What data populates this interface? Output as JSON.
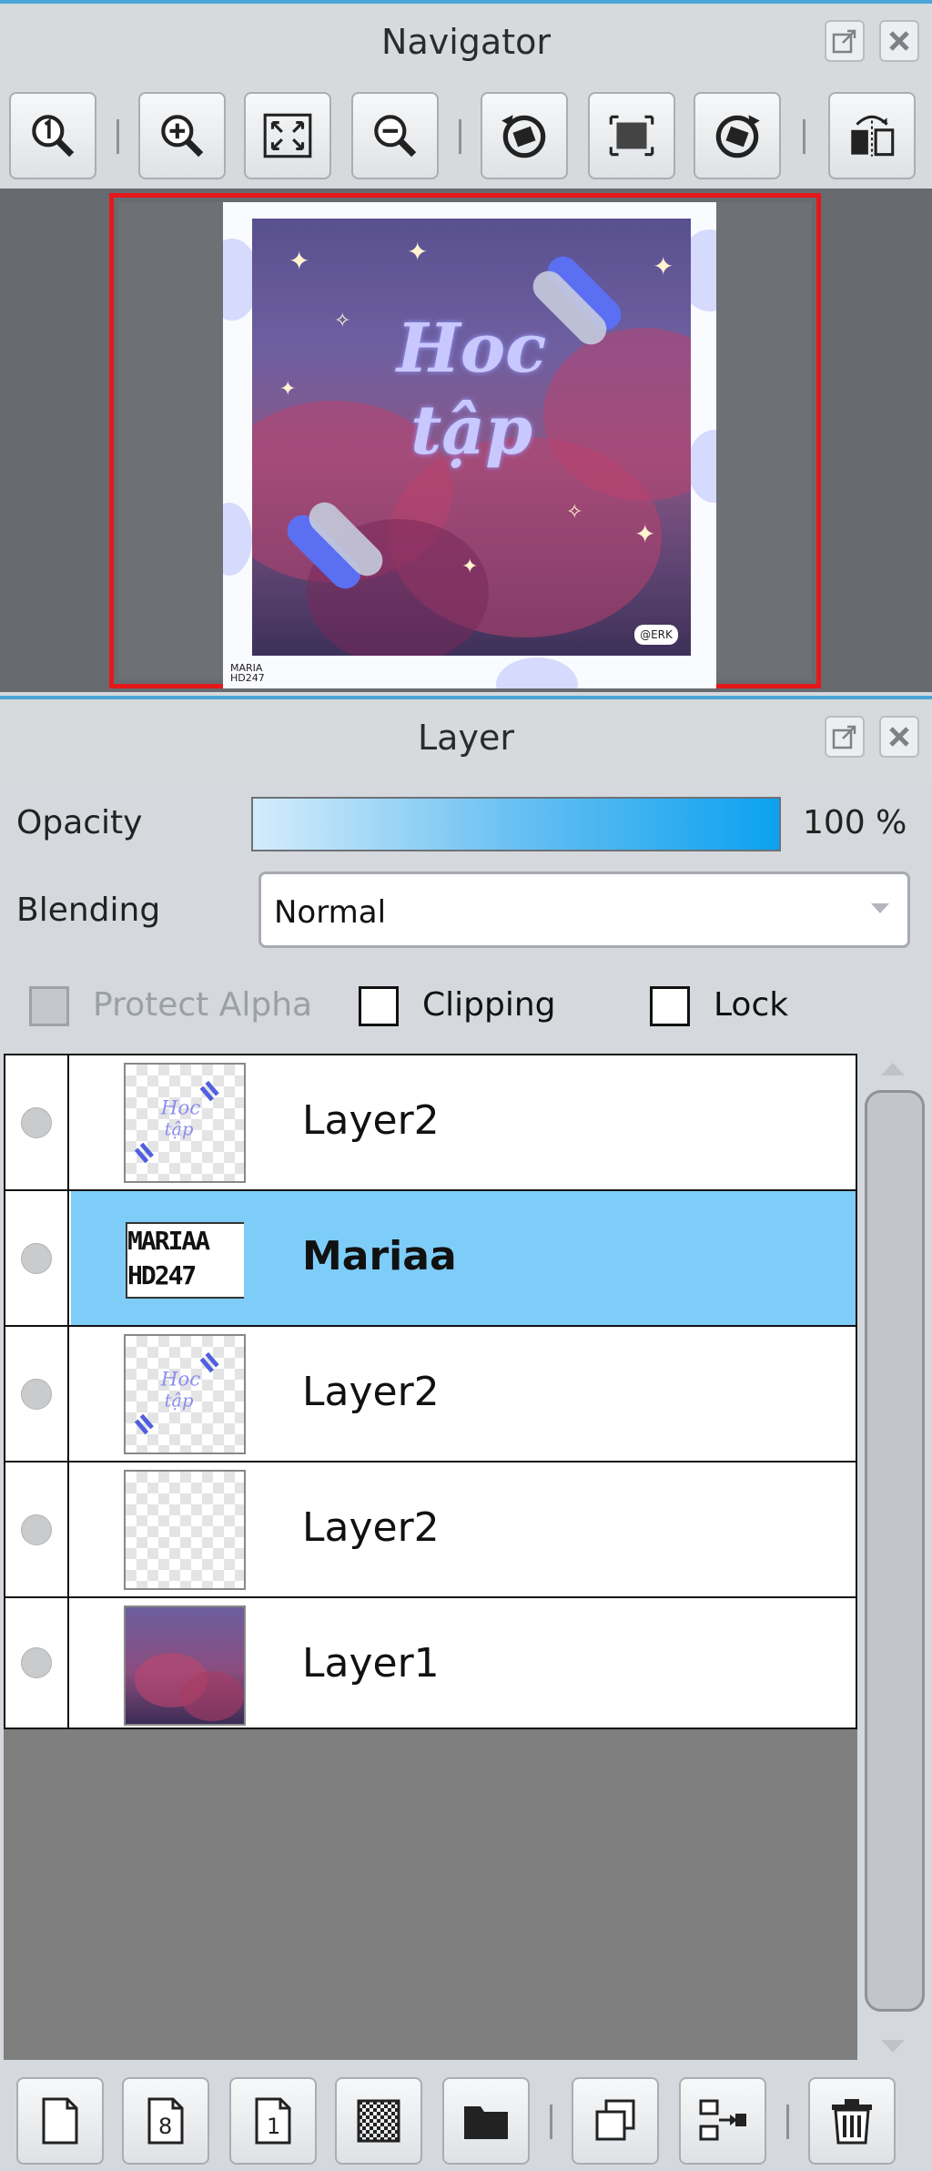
{
  "navigator": {
    "title": "Navigator",
    "toolbar": [
      {
        "name": "zoom-actual-icon"
      },
      {
        "name": "zoom-in-icon"
      },
      {
        "name": "fit-to-window-icon"
      },
      {
        "name": "zoom-out-icon"
      },
      {
        "name": "rotate-left-icon"
      },
      {
        "name": "reset-rotation-icon"
      },
      {
        "name": "rotate-right-icon"
      },
      {
        "name": "flip-horizontal-icon"
      }
    ],
    "preview": {
      "art_line1": "Hoc",
      "art_line2": "tập",
      "tag": "@ERK",
      "watermark_line1": "MARIA",
      "watermark_line2": "HD247"
    }
  },
  "layer_panel": {
    "title": "Layer",
    "opacity_label": "Opacity",
    "opacity_value": "100 %",
    "opacity": 1.0,
    "blending_label": "Blending",
    "blending_value": "Normal",
    "protect_alpha_label": "Protect Alpha",
    "clipping_label": "Clipping",
    "lock_label": "Lock",
    "layers": [
      {
        "name": "Layer2",
        "selected": false,
        "thumb": "text-art"
      },
      {
        "name": "Mariaa",
        "selected": true,
        "thumb": "watermark"
      },
      {
        "name": "Layer2",
        "selected": false,
        "thumb": "text-art"
      },
      {
        "name": "Layer2",
        "selected": false,
        "thumb": "empty"
      },
      {
        "name": "Layer1",
        "selected": false,
        "thumb": "photo"
      }
    ],
    "thumb_watermark_line1": "MARIAA",
    "thumb_watermark_line2": "HD247",
    "bottom_toolbar": [
      {
        "name": "new-layer-icon"
      },
      {
        "name": "new-8bit-layer-icon"
      },
      {
        "name": "new-1bit-layer-icon"
      },
      {
        "name": "new-halftone-layer-icon"
      },
      {
        "name": "new-folder-icon"
      },
      {
        "name": "duplicate-layer-icon"
      },
      {
        "name": "merge-down-icon"
      },
      {
        "name": "delete-layer-icon"
      }
    ]
  },
  "colors": {
    "accent": "#4aa6d8",
    "selected_row": "#7ecdf8",
    "navigator_frame": "#e4181b"
  }
}
